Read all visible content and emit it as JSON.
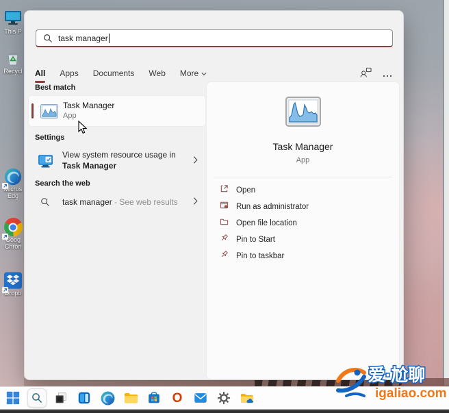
{
  "accent_color": "#8b3e3e",
  "search_panel": {
    "search_box": {
      "value": "task manager"
    },
    "tabs": [
      {
        "label": "All"
      },
      {
        "label": "Apps"
      },
      {
        "label": "Documents"
      },
      {
        "label": "Web"
      },
      {
        "label": "More"
      }
    ],
    "left": {
      "best_match_header": "Best match",
      "best_match_item": {
        "title": "Task Manager",
        "subtitle": "App"
      },
      "settings_header": "Settings",
      "settings_item": {
        "line1": "View system resource usage in",
        "line2": "Task Manager"
      },
      "web_header": "Search the web",
      "web_item": {
        "query": "task manager",
        "suffix": " - See web results"
      }
    },
    "right_panel": {
      "app_title": "Task Manager",
      "app_subtitle": "App",
      "actions": [
        {
          "label": "Open"
        },
        {
          "label": "Run as administrator"
        },
        {
          "label": "Open file location"
        },
        {
          "label": "Pin to Start"
        },
        {
          "label": "Pin to taskbar"
        }
      ]
    }
  },
  "desktop_icons": [
    {
      "label": "This P"
    },
    {
      "label": "Recycl"
    },
    {
      "label": "Micros Edg"
    },
    {
      "label": "Goog Chron"
    },
    {
      "label": "Dropb"
    }
  ],
  "watermark": {
    "title": "爱·尬聊",
    "url": "igaliao.com"
  }
}
